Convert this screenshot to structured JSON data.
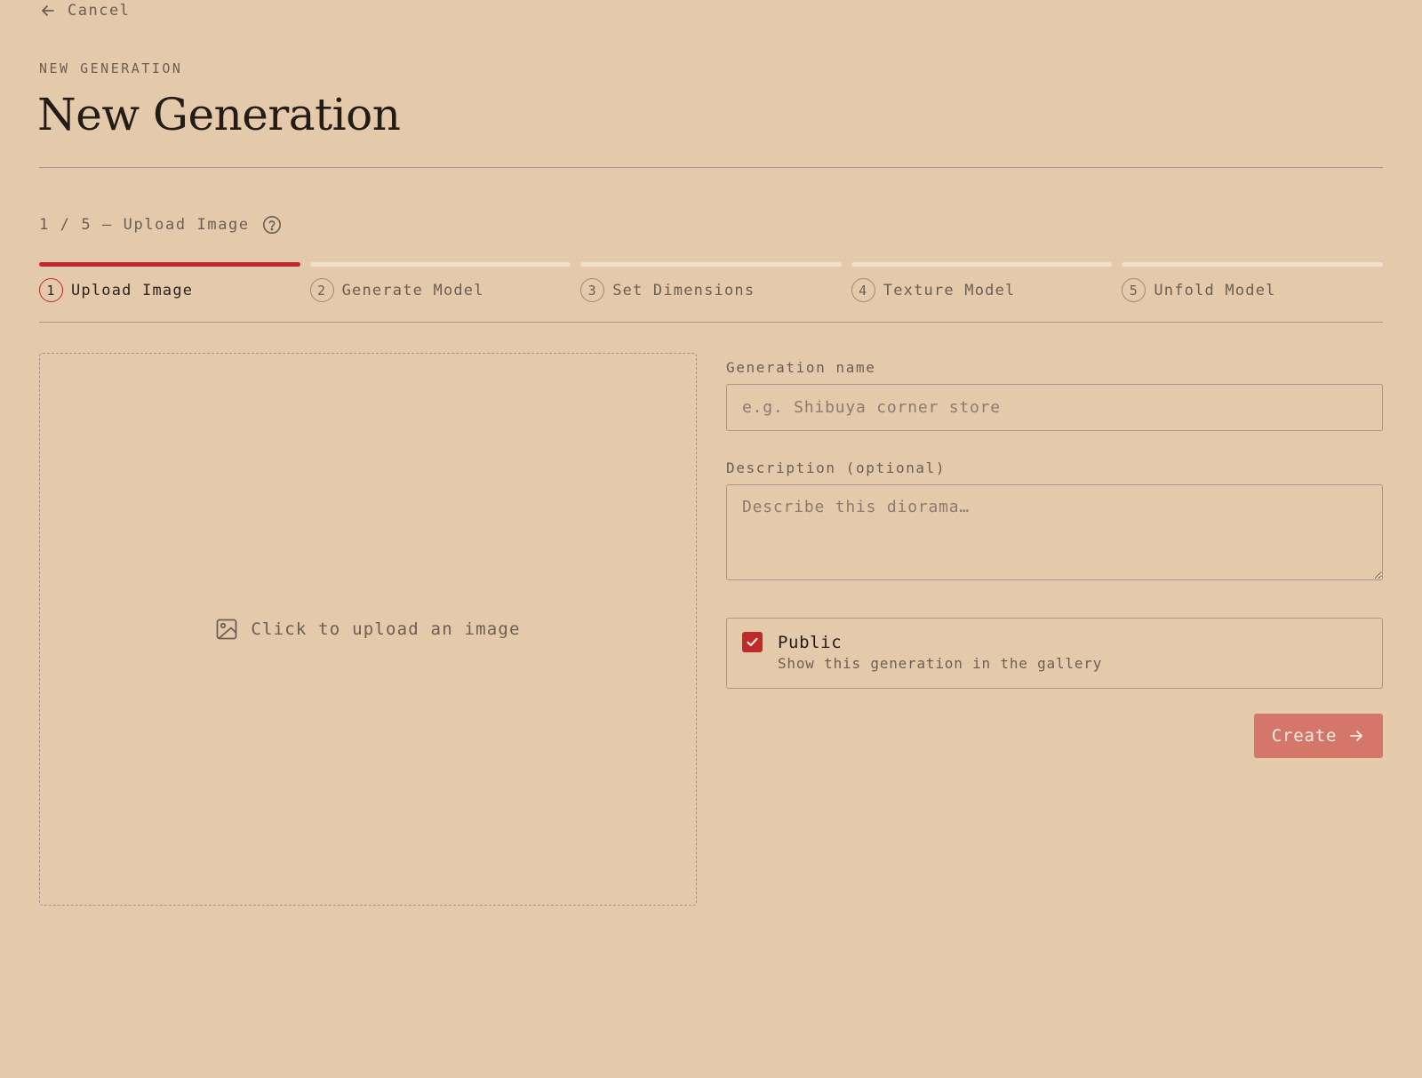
{
  "nav": {
    "cancel_label": "Cancel"
  },
  "header": {
    "eyebrow": "NEW GENERATION",
    "title": "New Generation"
  },
  "progress": {
    "caption": "1 / 5 — Upload Image",
    "current_step": 1,
    "total_steps": 5
  },
  "steps": [
    {
      "number": "1",
      "label": "Upload Image",
      "active": true
    },
    {
      "number": "2",
      "label": "Generate Model",
      "active": false
    },
    {
      "number": "3",
      "label": "Set Dimensions",
      "active": false
    },
    {
      "number": "4",
      "label": "Texture Model",
      "active": false
    },
    {
      "number": "5",
      "label": "Unfold Model",
      "active": false
    }
  ],
  "upload": {
    "prompt": "Click to upload an image",
    "icon": "image-icon"
  },
  "form": {
    "name_label": "Generation name",
    "name_value": "",
    "name_placeholder": "e.g. Shibuya corner store",
    "description_label": "Description (optional)",
    "description_value": "",
    "description_placeholder": "Describe this diorama…",
    "public_title": "Public",
    "public_subtitle": "Show this generation in the gallery",
    "public_checked": true,
    "create_label": "Create"
  },
  "colors": {
    "background": "#e4c9aa",
    "accent": "#bf2a2a",
    "button": "#d5766a",
    "inactive_bar": "#f0e1cf"
  }
}
